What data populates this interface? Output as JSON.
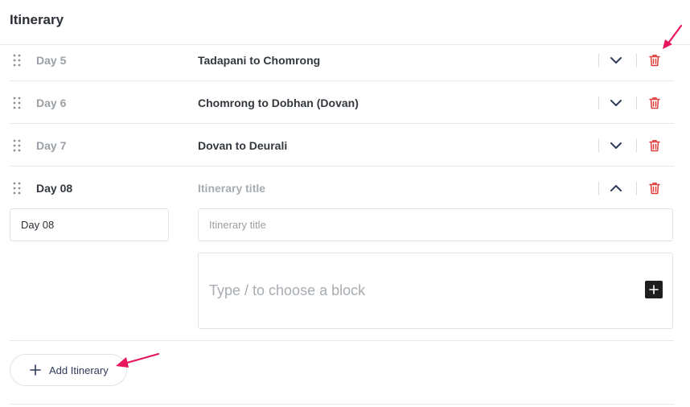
{
  "section": {
    "title": "Itinerary"
  },
  "rows": [
    {
      "day": "Day 5",
      "title": "Tadapani to Chomrong",
      "expanded": false
    },
    {
      "day": "Day 6",
      "title": "Chomrong to Dobhan (Dovan)",
      "expanded": false
    },
    {
      "day": "Day 7",
      "title": "Dovan to Deurali",
      "expanded": false
    },
    {
      "day": "Day 08",
      "title": "Itinerary title",
      "expanded": true
    }
  ],
  "editor": {
    "day_value": "Day 08",
    "title_placeholder": "Itinerary title",
    "content_placeholder": "Type / to choose a block"
  },
  "add_button": {
    "label": "Add Itinerary"
  },
  "icons": {
    "drag": "drag-handle-icon",
    "collapse": "chevron-down-icon",
    "expand": "chevron-up-icon",
    "delete": "trash-icon",
    "add": "plus-icon"
  },
  "colors": {
    "delete": "#e03c3c",
    "chevron": "#2e3a59",
    "annotation_arrow": "#e8175d",
    "block_button": "#1e1e1e"
  }
}
